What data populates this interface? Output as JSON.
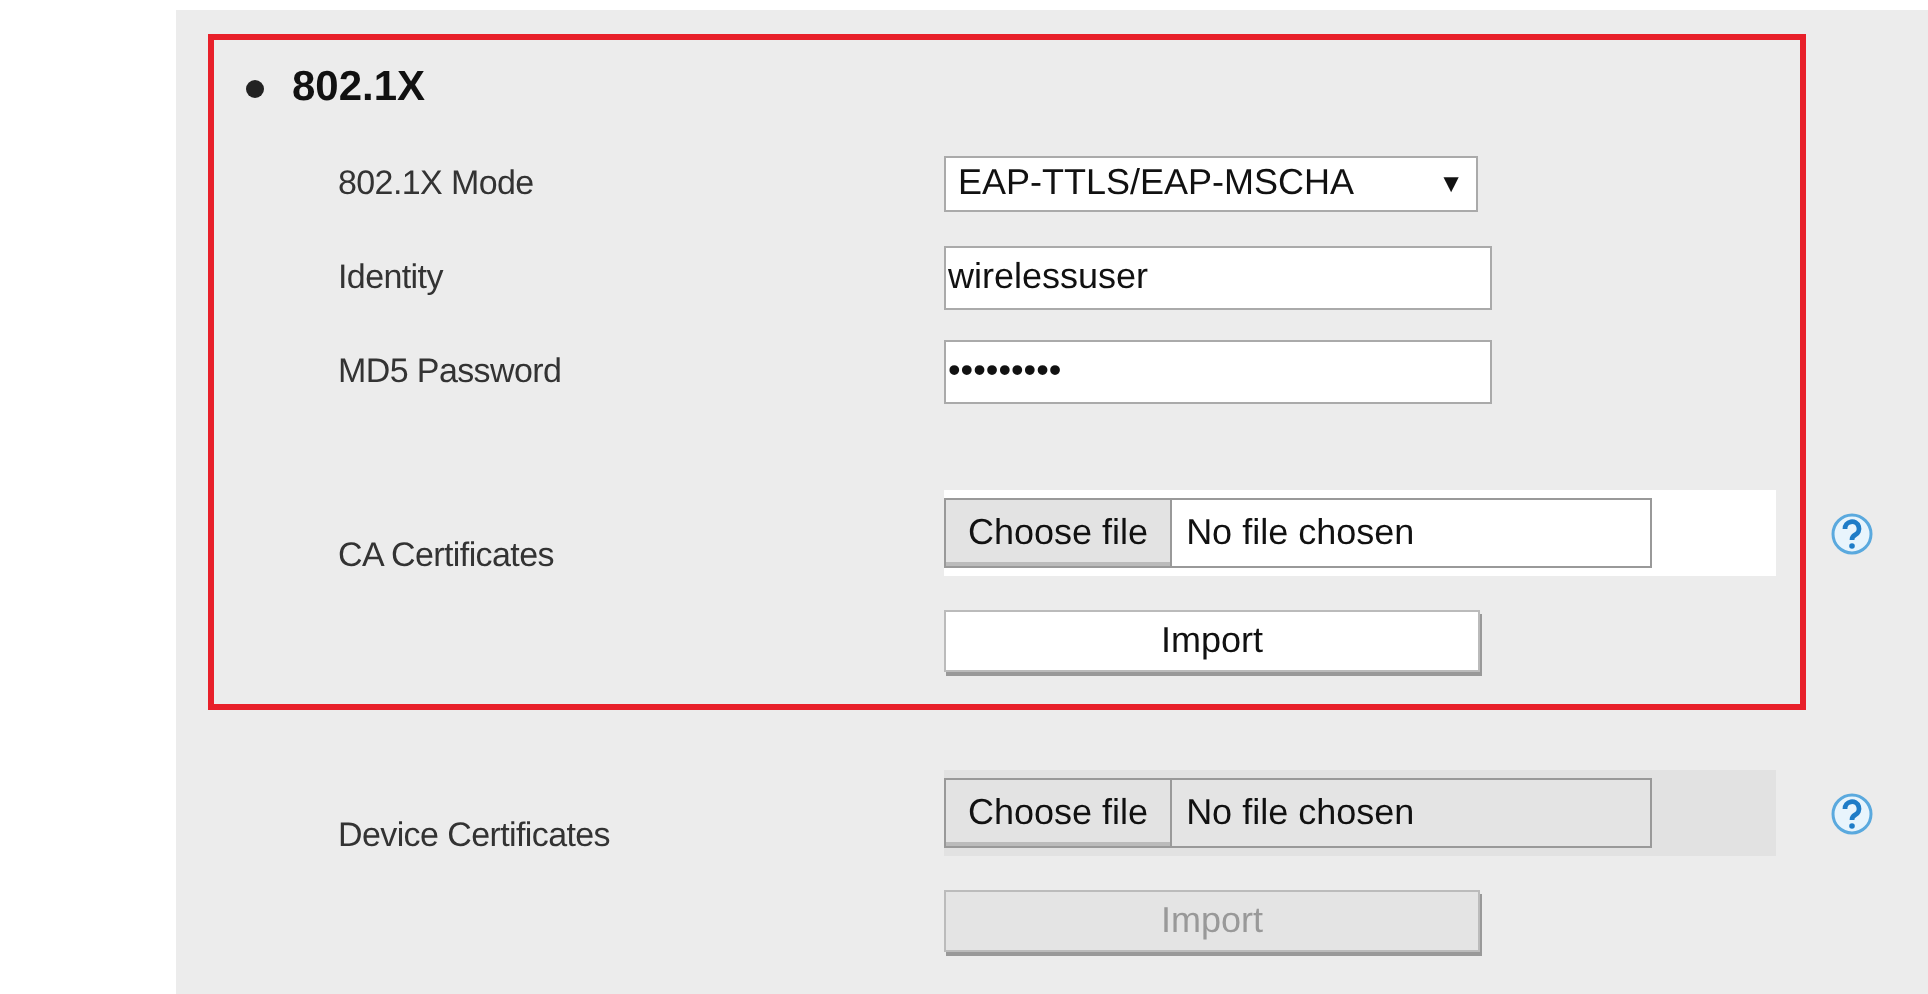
{
  "section": {
    "title": "802.1X",
    "highlighted": true,
    "fields": [
      {
        "kind": "select",
        "label": "802.1X Mode",
        "value": "EAP-TTLS/EAP-MSCHA",
        "arrow": "▼"
      },
      {
        "kind": "text",
        "label": "Identity",
        "value": "wirelessuser"
      },
      {
        "kind": "password",
        "label": "MD5 Password",
        "value": "•••••••••"
      }
    ],
    "certificates": [
      {
        "label": "CA Certificates",
        "choose": "Choose file",
        "status": "No file chosen",
        "import": "Import",
        "disabled": false
      },
      {
        "label": "Device Certificates",
        "choose": "Choose file",
        "status": "No file chosen",
        "import": "Import",
        "disabled": true
      }
    ]
  }
}
